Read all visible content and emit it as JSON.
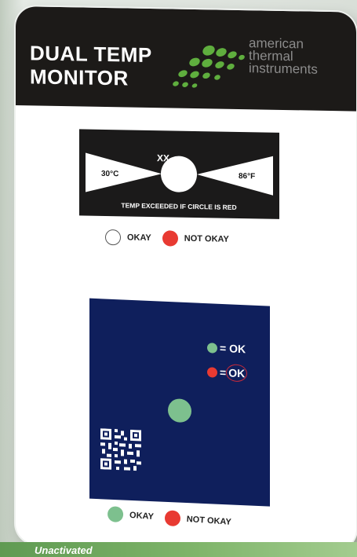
{
  "product": {
    "title_line1": "DUAL TEMP",
    "title_line2": "MONITOR",
    "brand": [
      "american",
      "thermal",
      "instruments"
    ]
  },
  "indicator": {
    "center_label": "XX",
    "left_temp": "30°C",
    "right_temp": "86°F",
    "footer": "TEMP EXCEEDED IF CIRCLE IS RED"
  },
  "legend_top": {
    "okay": "OKAY",
    "not_okay": "NOT OKAY"
  },
  "panel": {
    "ok_text": "= OK",
    "eq": "= ",
    "ok_circled": "OK"
  },
  "legend_bottom": {
    "okay": "OKAY",
    "not_okay": "NOT OKAY"
  },
  "caption": "Unactivated",
  "colors": {
    "header": "#1c1a18",
    "brand_green": "#5fae3e",
    "red": "#e83a32",
    "green": "#7dc08e",
    "panel_navy": "#0f1f5c"
  },
  "icons": [
    "brand-dots-logo",
    "qr-code-icon"
  ]
}
